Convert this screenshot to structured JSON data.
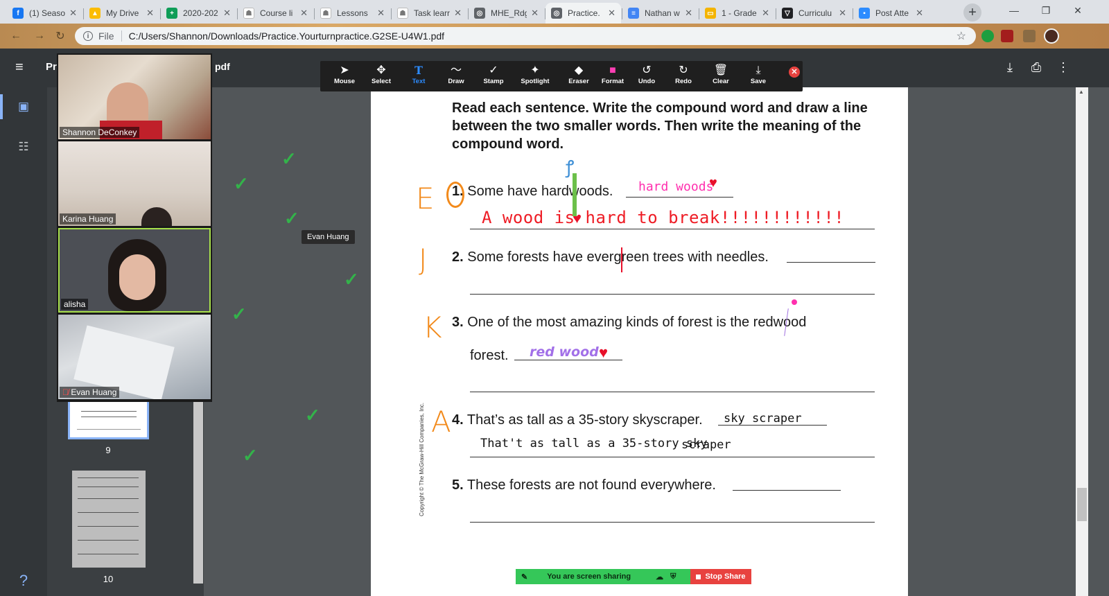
{
  "browser": {
    "tabs": [
      {
        "label": "(1) Seaso",
        "icon": "facebook-icon",
        "color": "#1877f2",
        "glyph": "f"
      },
      {
        "label": "My Drive",
        "icon": "google-drive-icon",
        "color": "#fbbc04",
        "glyph": "▲"
      },
      {
        "label": "2020-202",
        "icon": "google-sheets-icon",
        "color": "#0f9d58",
        "glyph": "+"
      },
      {
        "label": "Course li",
        "icon": "course-icon",
        "color": "#ffffff",
        "glyph": "☗"
      },
      {
        "label": "Lessons",
        "icon": "lessons-icon",
        "color": "#ffffff",
        "glyph": "☗"
      },
      {
        "label": "Task learr",
        "icon": "task-icon",
        "color": "#ffffff",
        "glyph": "☗"
      },
      {
        "label": "MHE_Rdg",
        "icon": "globe-icon",
        "color": "#5f6368",
        "glyph": "◎"
      },
      {
        "label": "Practice.",
        "icon": "globe-icon",
        "color": "#5f6368",
        "glyph": "◎"
      },
      {
        "label": "Nathan w",
        "icon": "google-docs-icon",
        "color": "#4285f4",
        "glyph": "≡"
      },
      {
        "label": "1 - Grade",
        "icon": "google-slides-icon",
        "color": "#f4b400",
        "glyph": "▭"
      },
      {
        "label": "Curriculu",
        "icon": "curriculum-icon",
        "color": "#202124",
        "glyph": "▽"
      },
      {
        "label": "Post Atte",
        "icon": "zoom-icon",
        "color": "#2d8cff",
        "glyph": "▪"
      }
    ],
    "active_tab_index": 7,
    "new_tab": "+",
    "address": {
      "scheme_label": "File",
      "url": "C:/Users/Shannon/Downloads/Practice.Yourturnpractice.G2SE-U4W1.pdf"
    }
  },
  "pdf_viewer": {
    "title_start": "Pr",
    "title_end": "pdf",
    "thumbnails": [
      {
        "page": "9"
      },
      {
        "page": "10"
      }
    ]
  },
  "annotation_toolbar": {
    "tools": [
      {
        "label": "Mouse",
        "icon": "mouse-pointer-icon",
        "glyph": "➤"
      },
      {
        "label": "Select",
        "icon": "move-icon",
        "glyph": "✥"
      },
      {
        "label": "Text",
        "icon": "text-icon",
        "glyph": "T"
      },
      {
        "label": "Draw",
        "icon": "draw-icon",
        "glyph": "〜"
      },
      {
        "label": "Stamp",
        "icon": "stamp-check-icon",
        "glyph": "✓"
      },
      {
        "label": "Spotlight",
        "icon": "spotlight-icon",
        "glyph": "✦"
      },
      {
        "label": "Eraser",
        "icon": "eraser-icon",
        "glyph": "◆"
      },
      {
        "label": "Format",
        "icon": "format-color-icon",
        "glyph": "■"
      },
      {
        "label": "Undo",
        "icon": "undo-icon",
        "glyph": "↺"
      },
      {
        "label": "Redo",
        "icon": "redo-icon",
        "glyph": "↻"
      },
      {
        "label": "Clear",
        "icon": "trash-icon",
        "glyph": "🗑"
      },
      {
        "label": "Save",
        "icon": "save-icon",
        "glyph": "⤓"
      }
    ],
    "active_tool": "Text",
    "format_color": "#ff3fb4"
  },
  "participants": [
    {
      "name": "Shannon DeConkey"
    },
    {
      "name": "Karina Huang"
    },
    {
      "name": "alisha"
    },
    {
      "name": "Evan Huang",
      "muted": true
    }
  ],
  "tooltip": "Evan Huang",
  "worksheet": {
    "instructions": "Read each sentence. Write the compound word and draw a line between the two smaller words. Then write the meaning of the compound word.",
    "items": [
      {
        "num": "1.",
        "text": "Some have hardwoods.",
        "answer": "hard woods",
        "meaning": "A wood is hard to break!!!!!!!!!!!!"
      },
      {
        "num": "2.",
        "text": "Some forests have evergreen trees with needles."
      },
      {
        "num": "3.",
        "text": "One of the most amazing kinds of forest is the redwood",
        "text2": "forest.",
        "answer": "red wood"
      },
      {
        "num": "4.",
        "text": "That’s as tall as a 35-story skyscraper.",
        "answer": "sky scraper",
        "meaning": "That't as tall as a 35-story sky",
        "meaning2": "scraper"
      },
      {
        "num": "5.",
        "text": "These forests are not found everywhere."
      }
    ],
    "margin_letters": [
      "E",
      "J",
      "K",
      "A"
    ],
    "copyright": "Copyright © The McGraw-Hill Companies, Inc."
  },
  "screen_share": {
    "status": "You are screen sharing",
    "stop_label": "Stop Share"
  }
}
